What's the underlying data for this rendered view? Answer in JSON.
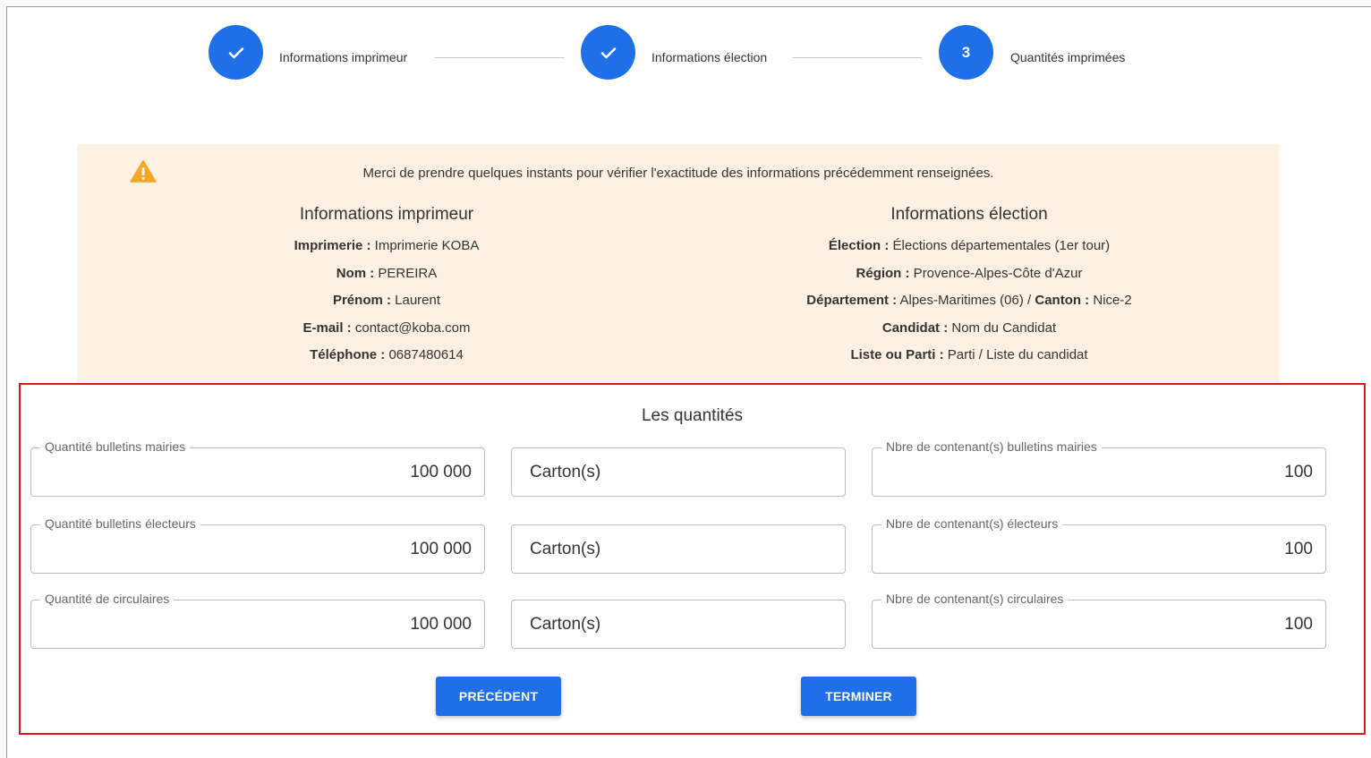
{
  "stepper": {
    "steps": [
      {
        "label": "Informations imprimeur",
        "state": "done",
        "icon": "check-icon"
      },
      {
        "label": "Informations élection",
        "state": "done",
        "icon": "check-icon"
      },
      {
        "label": "Quantités imprimées",
        "state": "active",
        "number": "3"
      }
    ]
  },
  "review": {
    "message": "Merci de prendre quelques instants pour vérifier l'exactitude des informations précédemment renseignées.",
    "printer": {
      "title": "Informations imprimeur",
      "rows": [
        {
          "label": "Imprimerie :",
          "value": " Imprimerie KOBA"
        },
        {
          "label": "Nom :",
          "value": " PEREIRA"
        },
        {
          "label": "Prénom :",
          "value": " Laurent"
        },
        {
          "label": "E-mail :",
          "value": " contact@koba.com"
        },
        {
          "label": "Téléphone :",
          "value": " 0687480614"
        }
      ]
    },
    "election": {
      "title": "Informations élection",
      "rows": [
        {
          "label": "Élection :",
          "value": " Élections départementales (1er tour)"
        },
        {
          "label": "Région :",
          "value": " Provence-Alpes-Côte d'Azur"
        },
        {
          "label": "Département :",
          "value": " Alpes-Maritimes (06) / ",
          "label2": "Canton :",
          "value2": " Nice-2"
        },
        {
          "label": "Candidat :",
          "value": " Nom du Candidat"
        },
        {
          "label": "Liste ou Parti :",
          "value": " Parti / Liste du candidat"
        }
      ]
    }
  },
  "quantities": {
    "title": "Les quantités",
    "rows": [
      {
        "qty_label": "Quantité bulletins mairies",
        "qty_value": "100 000",
        "unit": "Carton(s)",
        "count_label": "Nbre de contenant(s) bulletins mairies",
        "count_value": "100"
      },
      {
        "qty_label": "Quantité bulletins électeurs",
        "qty_value": "100 000",
        "unit": "Carton(s)",
        "count_label": "Nbre de contenant(s) électeurs",
        "count_value": "100"
      },
      {
        "qty_label": "Quantité de circulaires",
        "qty_value": "100 000",
        "unit": "Carton(s)",
        "count_label": "Nbre de contenant(s) circulaires",
        "count_value": "100"
      }
    ],
    "prev_label": "PRÉCÉDENT",
    "finish_label": "TERMINER"
  },
  "colors": {
    "primary": "#1e6fe8",
    "warning_bg": "#fef1e3",
    "warning_icon": "#f5a623",
    "highlight_border": "#e0141b"
  }
}
